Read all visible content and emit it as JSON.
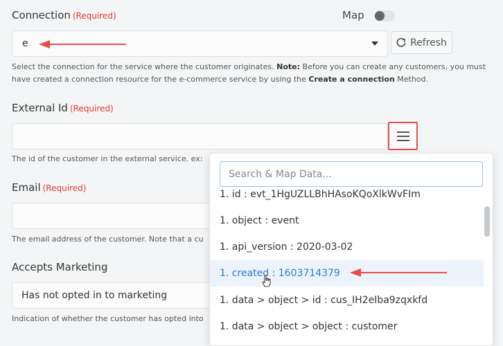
{
  "connection": {
    "label": "Connection",
    "required": "(Required)",
    "map_label": "Map",
    "selected_value": "e",
    "refresh_label": "Refresh",
    "help_prefix": "Select the connection for the service where the customer originates.",
    "help_note": "Note:",
    "help_middle": " Before you can create any customers, you must",
    "help_line2_prefix": "have created a connection resource for the e-commerce service by using the ",
    "help_link": "Create a connection",
    "help_line2_suffix": " Method."
  },
  "external_id": {
    "label": "External Id",
    "required": "(Required)",
    "help": "The id of the customer in the external service. ex:"
  },
  "email": {
    "label": "Email",
    "required": "(Required)",
    "help": "The email address of the customer. Note that a cu"
  },
  "accepts_marketing": {
    "label": "Accepts Marketing",
    "selected_value": "Has not opted in to marketing",
    "help": "Indication of whether the customer has opted into"
  },
  "dropdown": {
    "search_placeholder": "Search & Map Data...",
    "items": [
      {
        "label": "1. id : evt_1HgUZLLBhHAsoKQoXlkWvFIm"
      },
      {
        "label": "1. object : event"
      },
      {
        "label": "1. api_version : 2020-03-02"
      },
      {
        "label": "1. created : 1603714379"
      },
      {
        "label": "1. data > object > id : cus_IH2eIba9zqxkfd"
      },
      {
        "label": "1. data > object > object : customer"
      }
    ],
    "active_index": 3
  },
  "colors": {
    "accent": "#2b7cd3",
    "required": "#e53935",
    "annotation": "#e74c4c"
  }
}
